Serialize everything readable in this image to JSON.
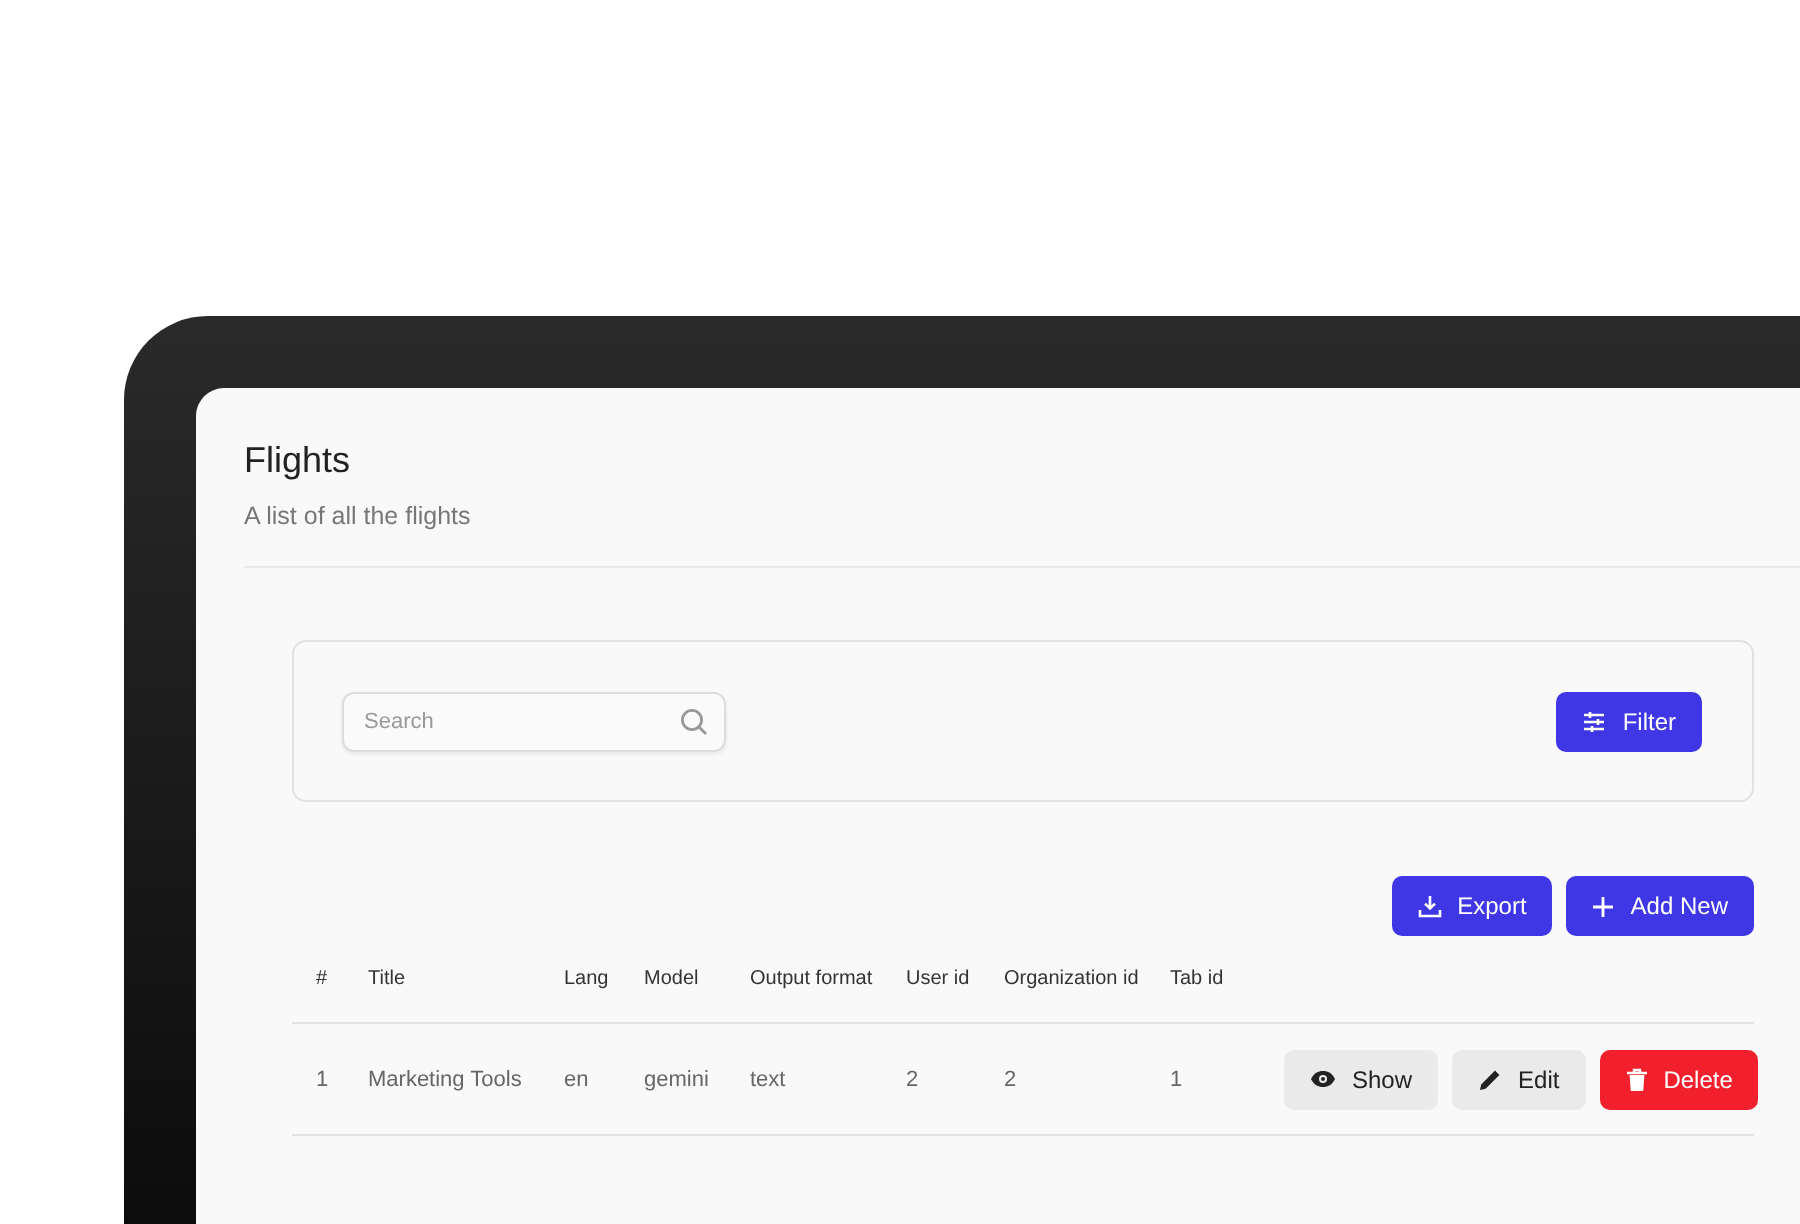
{
  "page": {
    "title": "Flights",
    "subtitle": "A list of all the flights"
  },
  "search": {
    "placeholder": "Search"
  },
  "filter_button": {
    "label": "Filter"
  },
  "toolbar": [
    {
      "kind": "export",
      "label": "Export"
    },
    {
      "kind": "add",
      "label": "Add New"
    }
  ],
  "table": {
    "columns": [
      "#",
      "Title",
      "Lang",
      "Model",
      "Output format",
      "User id",
      "Organization id",
      "Tab id"
    ],
    "rows": [
      {
        "cells": [
          "1",
          "Marketing Tools",
          "en",
          "gemini",
          "text",
          "2",
          "2",
          "1"
        ],
        "actions": [
          {
            "kind": "show",
            "label": "Show"
          },
          {
            "kind": "edit",
            "label": "Edit"
          },
          {
            "kind": "delete",
            "label": "Delete"
          }
        ]
      }
    ]
  }
}
